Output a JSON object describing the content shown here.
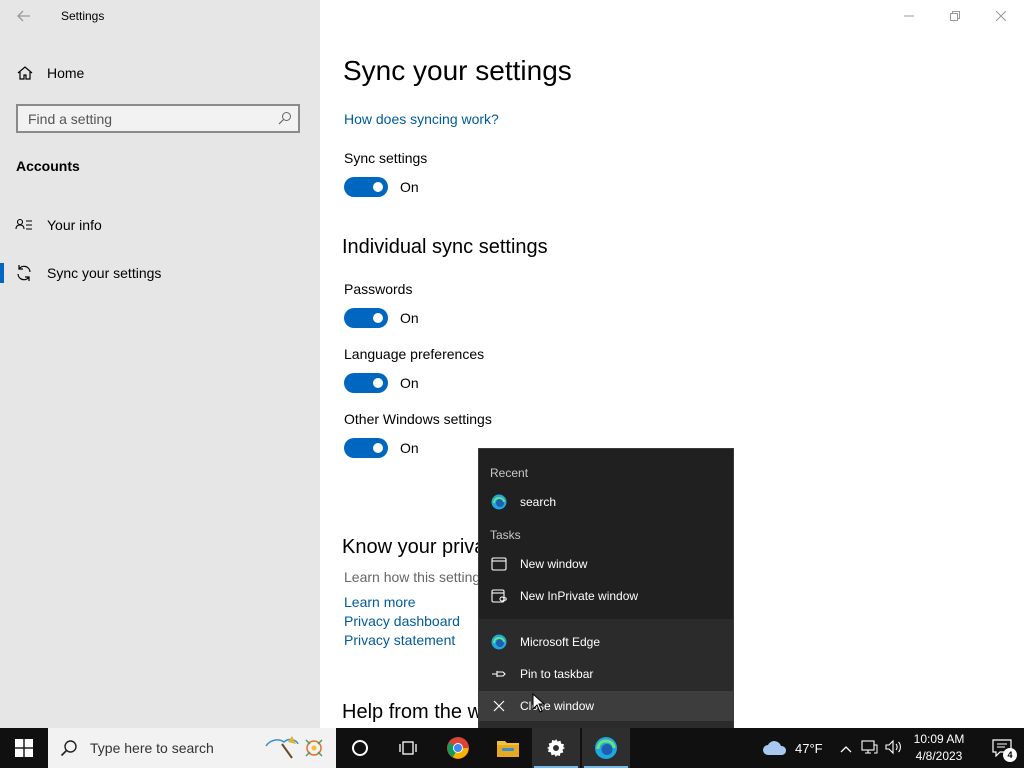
{
  "window": {
    "title": "Settings"
  },
  "sidebar": {
    "home_label": "Home",
    "search_placeholder": "Find a setting",
    "section": "Accounts",
    "items": [
      {
        "label": "Your info",
        "icon": "person-card-icon"
      },
      {
        "label": "Sync your settings",
        "icon": "sync-icon",
        "active": true
      }
    ]
  },
  "main": {
    "title": "Sync your settings",
    "how_link": "How does syncing work?",
    "sync_label": "Sync settings",
    "sync_state": "On",
    "individual_heading": "Individual sync settings",
    "individual": [
      {
        "label": "Passwords",
        "state": "On"
      },
      {
        "label": "Language preferences",
        "state": "On"
      },
      {
        "label": "Other Windows settings",
        "state": "On"
      }
    ],
    "privacy_heading": "Know your priva",
    "privacy_text": "Learn how this setting",
    "learn_more": "Learn more",
    "privacy_dashboard": "Privacy dashboard",
    "privacy_statement": "Privacy statement",
    "help_heading": "Help from the w"
  },
  "jumplist": {
    "recent_label": "Recent",
    "recent_item": "search",
    "tasks_label": "Tasks",
    "new_window": "New window",
    "new_inprivate": "New InPrivate window",
    "app_name": "Microsoft Edge",
    "pin": "Pin to taskbar",
    "close": "Close window"
  },
  "taskbar": {
    "search_placeholder": "Type here to search",
    "weather": "47°F",
    "time": "10:09 AM",
    "date": "4/8/2023",
    "notification_count": "4"
  },
  "colors": {
    "accent": "#0067c0",
    "link": "#005a9e",
    "sidebar_bg": "#e6e6e6",
    "taskbar_bg": "#101010"
  }
}
